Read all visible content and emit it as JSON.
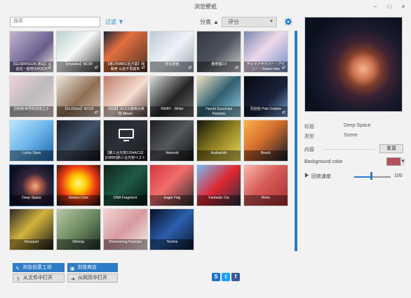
{
  "window": {
    "title": "浏览壁纸",
    "buttons": [
      "−",
      "□",
      "×"
    ]
  },
  "toolbar": {
    "search_placeholder": "搜索",
    "filter_label": "过滤",
    "sort_label": "分类",
    "sort_value": "评分"
  },
  "grid": {
    "tiles": [
      {
        "title": "【GUSRINGOK-表白】从此在一起吧 EPOCH",
        "mark": "⇄"
      },
      {
        "title": "【mysaka】NCOF",
        "mark": "⇄"
      },
      {
        "title": "【第1市MINC后方富】和萌舍 从此不再孤单",
        "mark": "⇄"
      },
      {
        "title": "空の迷宫",
        "mark": "⇄"
      },
      {
        "title": "春卷猫2.0",
        "mark": "⇄"
      },
      {
        "title": "チャイナサイバー・アイ二ー・Sweet robe",
        "mark": "⇄"
      },
      {
        "title": "回到新世界的创造之子",
        "mark": ""
      },
      {
        "title": "【GLRSink】NCOF",
        "mark": "⇄"
      },
      {
        "title": "【琉球】ALICE猫咪水族馆 Album",
        "mark": ""
      },
      {
        "title": "RWBY - White",
        "mark": ""
      },
      {
        "title": "Haruhi Suzumiya Particles",
        "mark": ""
      },
      {
        "title": "羽丝柏 Pink Dolphin",
        "mark": "⇄"
      },
      {
        "title": "Lucky Stars",
        "mark": ""
      },
      {
        "title": "",
        "mark": ""
      },
      {
        "title": "【聚三合光管1264ACS】[1080P]新三合光管ベストシーン集",
        "mark": ""
      },
      {
        "title": "Asteroid",
        "mark": ""
      },
      {
        "title": "Audiophile",
        "mark": ""
      },
      {
        "title": "Beach",
        "mark": ""
      },
      {
        "title": "Deep Space",
        "mark": ""
      },
      {
        "title": "Demon Core",
        "mark": ""
      },
      {
        "title": "DNA Fragment",
        "mark": ""
      },
      {
        "title": "Eagle Flag",
        "mark": ""
      },
      {
        "title": "Fantastic Car",
        "mark": ""
      },
      {
        "title": "Retro",
        "mark": ""
      },
      {
        "title": "Rocepod",
        "mark": ""
      },
      {
        "title": "Shinrpu",
        "mark": ""
      },
      {
        "title": "Shimmering Particles",
        "mark": ""
      },
      {
        "title": "Techno",
        "mark": ""
      }
    ]
  },
  "details": {
    "title_label": "标题",
    "title_value": "Deep Space",
    "type_label": "类型",
    "type_value": "Scene",
    "content_label": "内容",
    "reset_button": "重置",
    "background_color_label": "Background color",
    "background_color": "#b6505d",
    "playback_speed_label": "回放速度",
    "playback_speed_value": "100",
    "playback_speed_fraction": 0.48
  },
  "bottom": {
    "workshop_button": "浏览创意工坊",
    "store_button": "浏览商店",
    "open_file_button": "从文件中打开",
    "open_web_button": "从网页中打开"
  },
  "colors": {
    "accent": "#2d7cc8",
    "steam": "#1c73c6",
    "twitter": "#1da1f2",
    "facebook": "#3b5998"
  },
  "icons": {
    "search": "search-icon",
    "filter": "funnel-icon",
    "settings": "gear-icon",
    "steam": "steam-icon",
    "twitter": "twitter-icon",
    "facebook": "facebook-icon"
  }
}
